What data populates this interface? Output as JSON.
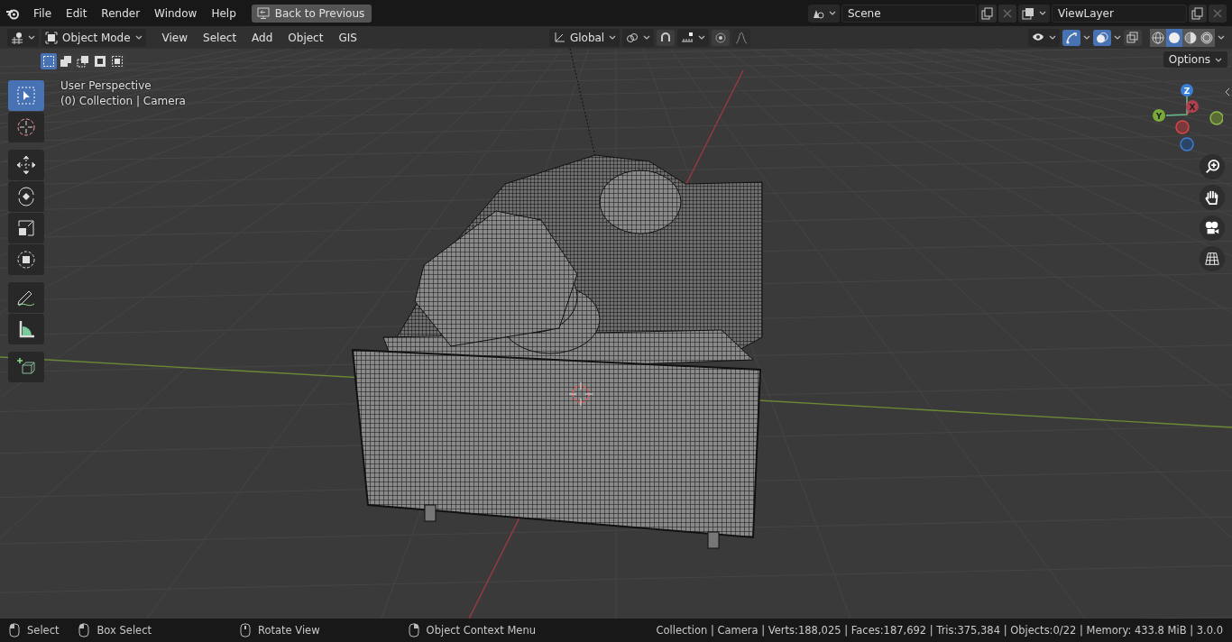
{
  "menu_bar": {
    "menus": [
      "File",
      "Edit",
      "Render",
      "Window",
      "Help"
    ],
    "back_button": "Back to Previous",
    "scene": "Scene",
    "view_layer": "ViewLayer"
  },
  "header": {
    "mode": "Object Mode",
    "menus": [
      "View",
      "Select",
      "Add",
      "Object",
      "GIS"
    ],
    "orientation": "Global",
    "select_modes": [
      {
        "selected": true
      },
      {
        "selected": false
      },
      {
        "selected": false
      },
      {
        "selected": false
      },
      {
        "selected": false
      }
    ],
    "toggles": [
      {
        "kind": "snap",
        "on": false
      },
      {
        "kind": "proportional",
        "on": false
      },
      {
        "kind": "gizmos",
        "on": true
      },
      {
        "kind": "overlays",
        "on": true
      },
      {
        "kind": "xray",
        "on": false
      }
    ],
    "shading_modes": [
      {
        "selected": false
      },
      {
        "selected": true
      },
      {
        "selected": false
      },
      {
        "selected": false
      }
    ],
    "options": "Options"
  },
  "toolbar": [
    {
      "kind": "select",
      "selected": true
    },
    {
      "kind": "cursor",
      "selected": false
    },
    {
      "kind": "move",
      "selected": false
    },
    {
      "kind": "rotate",
      "selected": false
    },
    {
      "kind": "scale",
      "selected": false
    },
    {
      "kind": "transform",
      "selected": false
    },
    {
      "kind": "annotate",
      "selected": false
    },
    {
      "kind": "measure",
      "selected": false
    },
    {
      "kind": "add_cube",
      "selected": false
    }
  ],
  "viewport": {
    "view_name": "User Perspective",
    "collection": "(0) Collection | Camera",
    "axes": [
      "Z",
      "X",
      "Y"
    ]
  },
  "status_bar": {
    "hints": [
      {
        "kind": "left",
        "label": "Select"
      },
      {
        "kind": "drag",
        "label": "Box Select"
      },
      {
        "kind": "middle",
        "label": "Rotate View"
      },
      {
        "kind": "right",
        "label": "Object Context Menu"
      }
    ],
    "stats": "Collection | Camera | Verts:188,025 | Faces:187,692 | Tris:375,384 | Objects:0/22 | Memory: 433.8 MiB | 3.0.0"
  }
}
